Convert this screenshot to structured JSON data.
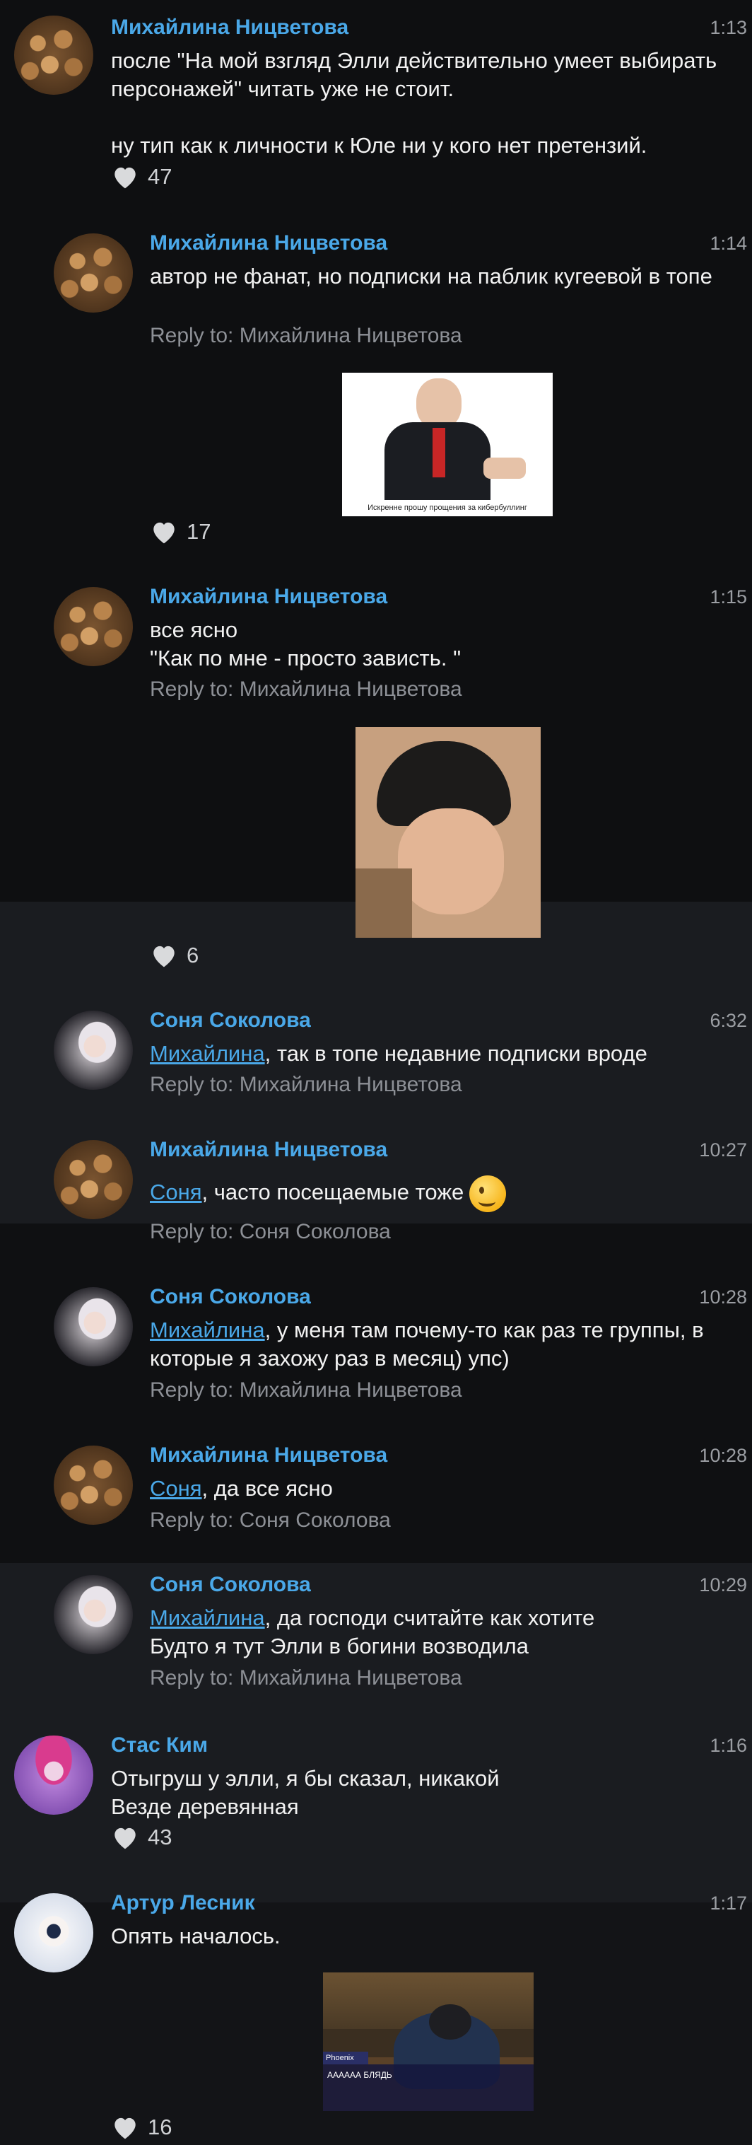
{
  "comments": [
    {
      "author": "Михайлина Ницветова",
      "time": "1:13",
      "lines": "после \"На мой взгляд Элли действительно умеет выбирать персонажей\" читать уже не стоит.\n\nну тип как к личности к Юле ни у кого нет претензий.",
      "likes": "47"
    },
    {
      "author": "Михайлина Ницветова",
      "time": "1:14",
      "lines": "автор не фанат, но подписки на паблик кугеевой в топе",
      "reply": "Reply to: Михайлина Ницветова",
      "image_caption": "Искренне прошу прощения за кибербуллинг",
      "likes": "17"
    },
    {
      "author": "Михайлина Ницветова",
      "time": "1:15",
      "lines": "все ясно\n\"Как по мне - просто зависть. \"",
      "reply": "Reply to: Михайлина Ницветова",
      "likes": "6"
    },
    {
      "author": "Соня Соколова",
      "time": "6:32",
      "mention": "Михайлина",
      "lines": ", так в топе недавние подписки вроде",
      "reply": "Reply to: Михайлина Ницветова"
    },
    {
      "author": "Михайлина Ницветова",
      "time": "10:27",
      "mention": "Соня",
      "lines": ", часто посещаемые тоже",
      "reply": "Reply to: Соня Соколова"
    },
    {
      "author": "Соня Соколова",
      "time": "10:28",
      "mention": "Михайлина",
      "lines": ", у меня там почему-то как раз те группы, в которые я захожу раз в месяц) упс)",
      "reply": "Reply to: Михайлина Ницветова"
    },
    {
      "author": "Михайлина Ницветова",
      "time": "10:28",
      "mention": "Соня",
      "lines": ", да все ясно",
      "reply": "Reply to: Соня Соколова"
    },
    {
      "author": "Соня Соколова",
      "time": "10:29",
      "mention": "Михайлина",
      "lines": ", да господи считайте как хотите\nБудто я тут Элли в богини возводила",
      "reply": "Reply to: Михайлина Ницветова"
    },
    {
      "author": "Стас Ким",
      "time": "1:16",
      "lines": "Отыгруш у элли, я бы сказал, никакой\nВезде деревянная",
      "likes": "43"
    },
    {
      "author": "Артур Лесник",
      "time": "1:17",
      "lines": "Опять началось.",
      "image_name": "Phoenix",
      "image_caption": "АААААА БЛЯДЬ",
      "likes": "16"
    }
  ],
  "colors": {
    "name": "#4aa8e8",
    "bg": "#0e0f11",
    "bg_alt": "#1a1c20"
  }
}
